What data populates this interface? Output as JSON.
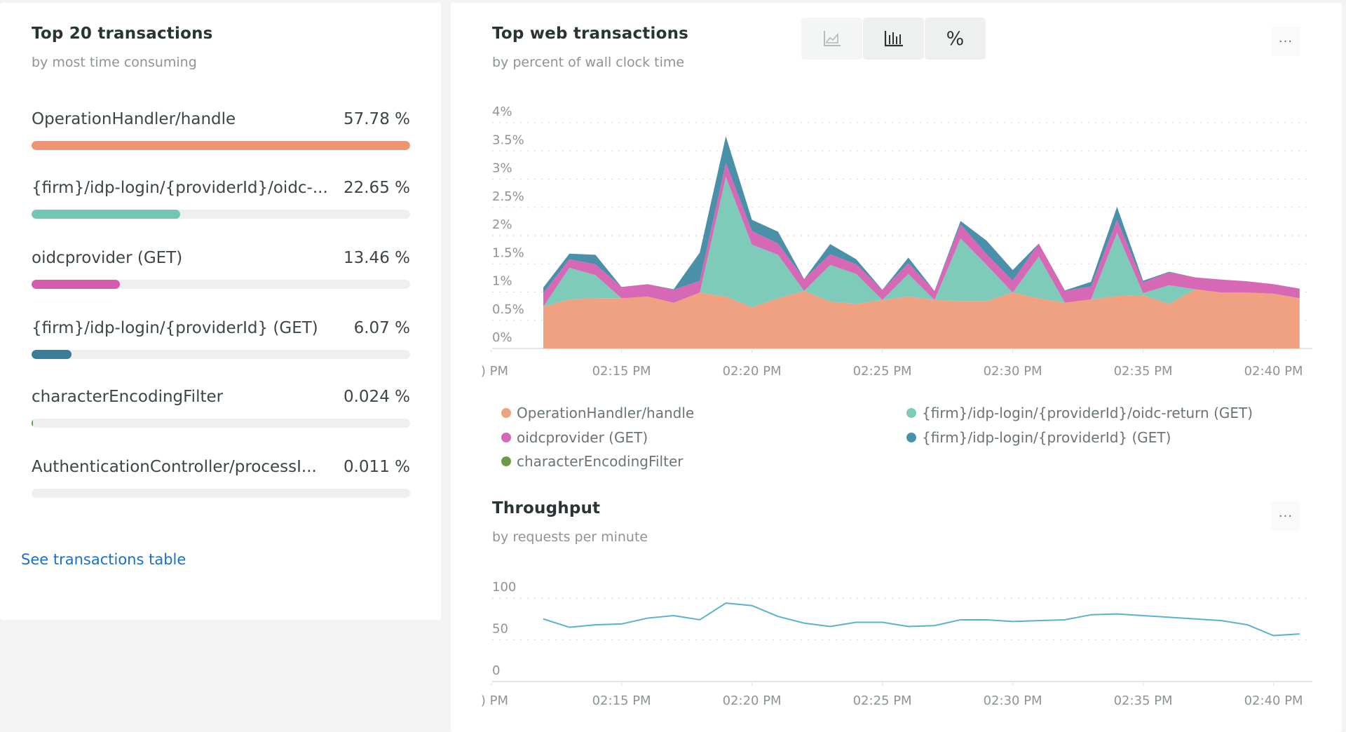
{
  "left_panel": {
    "title": "Top 20 transactions",
    "subtitle": "by most time consuming",
    "transactions": [
      {
        "label": "OperationHandler/handle",
        "percent_text": "57.78 %",
        "bar_fraction": 1.0,
        "color": "#ef9472"
      },
      {
        "label": "{firm}/idp-login/{providerId}/oidc-...",
        "percent_text": "22.65 %",
        "bar_fraction": 0.392,
        "color": "#72c7b3"
      },
      {
        "label": "oidcprovider (GET)",
        "percent_text": "13.46 %",
        "bar_fraction": 0.233,
        "color": "#d65aae"
      },
      {
        "label": "{firm}/idp-login/{providerId} (GET)",
        "percent_text": "6.07 %",
        "bar_fraction": 0.105,
        "color": "#3a7d9a"
      },
      {
        "label": "characterEncodingFilter",
        "percent_text": "0.024 %",
        "bar_fraction": 0.0004,
        "color": "#6a9a46"
      },
      {
        "label": "AuthenticationController/processI...",
        "percent_text": "0.011 %",
        "bar_fraction": 0.0002,
        "color": "#c9a227"
      }
    ],
    "link_label": "See transactions table"
  },
  "web_panel": {
    "title": "Top web transactions",
    "subtitle": "by percent of wall clock time",
    "toggles": [
      {
        "name": "area-chart",
        "icon": "area-chart-icon",
        "selected": false
      },
      {
        "name": "bar-chart",
        "icon": "bar-chart-icon",
        "selected": true
      },
      {
        "name": "percent",
        "label": "%",
        "selected": true
      }
    ],
    "more_label": "···"
  },
  "throughput_panel": {
    "title": "Throughput",
    "subtitle": "by requests per minute",
    "more_label": "···"
  },
  "chart_data": [
    {
      "type": "area",
      "stacked": true,
      "title": "Top web transactions",
      "subtitle": "by percent of wall clock time",
      "xlabel": "",
      "ylabel": "",
      "x": [
        "02:12 PM",
        "02:13 PM",
        "02:14 PM",
        "02:15 PM",
        "02:16 PM",
        "02:17 PM",
        "02:18 PM",
        "02:19 PM",
        "02:20 PM",
        "02:21 PM",
        "02:22 PM",
        "02:23 PM",
        "02:24 PM",
        "02:25 PM",
        "02:26 PM",
        "02:27 PM",
        "02:28 PM",
        "02:29 PM",
        "02:30 PM",
        "02:31 PM",
        "02:32 PM",
        "02:33 PM",
        "02:34 PM",
        "02:35 PM",
        "02:36 PM",
        "02:37 PM",
        "02:38 PM",
        "02:39 PM",
        "02:40 PM",
        "02:41 PM"
      ],
      "x_minutes": [
        12,
        13,
        14,
        15,
        16,
        17,
        18,
        19,
        20,
        21,
        22,
        23,
        24,
        25,
        26,
        27,
        28,
        29,
        30,
        31,
        32,
        33,
        34,
        35,
        36,
        37,
        38,
        39,
        40,
        41
      ],
      "x_range_minutes": [
        9.9,
        41.45
      ],
      "xticks": [
        {
          "minute": 10,
          "label": ") PM"
        },
        {
          "minute": 15,
          "label": "02:15 PM"
        },
        {
          "minute": 20,
          "label": "02:20 PM"
        },
        {
          "minute": 25,
          "label": "02:25 PM"
        },
        {
          "minute": 30,
          "label": "02:30 PM"
        },
        {
          "minute": 35,
          "label": "02:35 PM"
        },
        {
          "minute": 40,
          "label": "02:40 PM"
        }
      ],
      "ylim": [
        0,
        4
      ],
      "yticks": [
        {
          "value": 0,
          "label": "0%"
        },
        {
          "value": 0.5,
          "label": "0.5%"
        },
        {
          "value": 1,
          "label": "1%"
        },
        {
          "value": 1.5,
          "label": "1.5%"
        },
        {
          "value": 2,
          "label": "2%"
        },
        {
          "value": 2.5,
          "label": "2.5%"
        },
        {
          "value": 3,
          "label": "3%"
        },
        {
          "value": 3.5,
          "label": "3.5%"
        },
        {
          "value": 4,
          "label": "4%"
        }
      ],
      "grid": true,
      "legend_position": "bottom",
      "series": [
        {
          "name": "OperationHandler/handle",
          "color": "#f0a182",
          "values": [
            0.74,
            0.87,
            0.89,
            0.89,
            0.92,
            0.81,
            0.99,
            0.92,
            0.73,
            0.89,
            1.02,
            0.83,
            0.79,
            0.86,
            0.92,
            0.86,
            0.84,
            0.84,
            0.99,
            0.89,
            0.81,
            0.87,
            0.93,
            0.94,
            0.79,
            1.05,
            0.99,
            0.99,
            0.97,
            0.89
          ]
        },
        {
          "name": "{firm}/idp-login/{providerId}/oidc-return (GET)",
          "color": "#7ecbba",
          "values": [
            0,
            0.56,
            0.41,
            0,
            0,
            0,
            0,
            2.12,
            1.11,
            0.77,
            0,
            0.65,
            0.53,
            0,
            0.4,
            0,
            1.11,
            0.64,
            0,
            0.74,
            0,
            0,
            1.12,
            0.04,
            0.33,
            0,
            0,
            0,
            0,
            0
          ]
        },
        {
          "name": "oidcprovider (GET)",
          "color": "#d768b6",
          "values": [
            0.24,
            0.15,
            0.19,
            0.2,
            0.22,
            0.23,
            0.21,
            0.25,
            0.24,
            0.2,
            0.21,
            0.19,
            0.17,
            0.18,
            0.19,
            0.16,
            0.25,
            0.19,
            0.21,
            0.23,
            0.21,
            0.23,
            0.23,
            0.19,
            0.23,
            0.21,
            0.23,
            0.2,
            0.17,
            0.17
          ]
        },
        {
          "name": "{firm}/idp-login/{providerId} (GET)",
          "color": "#4a90a8",
          "values": [
            0.1,
            0.1,
            0.17,
            0,
            0,
            0.01,
            0.5,
            0.47,
            0.2,
            0.21,
            0,
            0.18,
            0.09,
            0,
            0.1,
            0,
            0.06,
            0.24,
            0.19,
            0,
            0.01,
            0.08,
            0.23,
            0.03,
            0.01,
            0,
            0,
            0,
            0,
            0
          ]
        },
        {
          "name": "characterEncodingFilter",
          "color": "#6a9a46",
          "values": [
            0,
            0,
            0,
            0,
            0,
            0,
            0,
            0,
            0,
            0,
            0,
            0,
            0,
            0,
            0,
            0,
            0,
            0,
            0,
            0,
            0,
            0,
            0,
            0,
            0,
            0,
            0,
            0,
            0,
            0
          ]
        }
      ]
    },
    {
      "type": "line",
      "title": "Throughput",
      "subtitle": "by requests per minute",
      "xlabel": "",
      "ylabel": "",
      "x": [
        "02:12 PM",
        "02:13 PM",
        "02:14 PM",
        "02:15 PM",
        "02:16 PM",
        "02:17 PM",
        "02:18 PM",
        "02:19 PM",
        "02:20 PM",
        "02:21 PM",
        "02:22 PM",
        "02:23 PM",
        "02:24 PM",
        "02:25 PM",
        "02:26 PM",
        "02:27 PM",
        "02:28 PM",
        "02:29 PM",
        "02:30 PM",
        "02:31 PM",
        "02:32 PM",
        "02:33 PM",
        "02:34 PM",
        "02:35 PM",
        "02:36 PM",
        "02:37 PM",
        "02:38 PM",
        "02:39 PM",
        "02:40 PM",
        "02:41 PM"
      ],
      "x_minutes": [
        12,
        13,
        14,
        15,
        16,
        17,
        18,
        19,
        20,
        21,
        22,
        23,
        24,
        25,
        26,
        27,
        28,
        29,
        30,
        31,
        32,
        33,
        34,
        35,
        36,
        37,
        38,
        39,
        40,
        41
      ],
      "x_range_minutes": [
        9.9,
        41.45
      ],
      "xticks": [
        {
          "minute": 10,
          "label": ") PM"
        },
        {
          "minute": 15,
          "label": "02:15 PM"
        },
        {
          "minute": 20,
          "label": "02:20 PM"
        },
        {
          "minute": 25,
          "label": "02:25 PM"
        },
        {
          "minute": 30,
          "label": "02:30 PM"
        },
        {
          "minute": 35,
          "label": "02:35 PM"
        },
        {
          "minute": 40,
          "label": "02:40 PM"
        }
      ],
      "ylim": [
        0,
        100
      ],
      "yticks": [
        {
          "value": 0,
          "label": "0"
        },
        {
          "value": 50,
          "label": "50"
        },
        {
          "value": 100,
          "label": "100"
        }
      ],
      "grid": true,
      "series": [
        {
          "name": "Throughput",
          "color": "#5ab2cf",
          "values": [
            75,
            65,
            68,
            69,
            76,
            79,
            74,
            94,
            91,
            78,
            70,
            66,
            71,
            71,
            66,
            67,
            74,
            74,
            72,
            73,
            74,
            80,
            81,
            79,
            77,
            75,
            73,
            68,
            55,
            57
          ]
        }
      ]
    }
  ]
}
